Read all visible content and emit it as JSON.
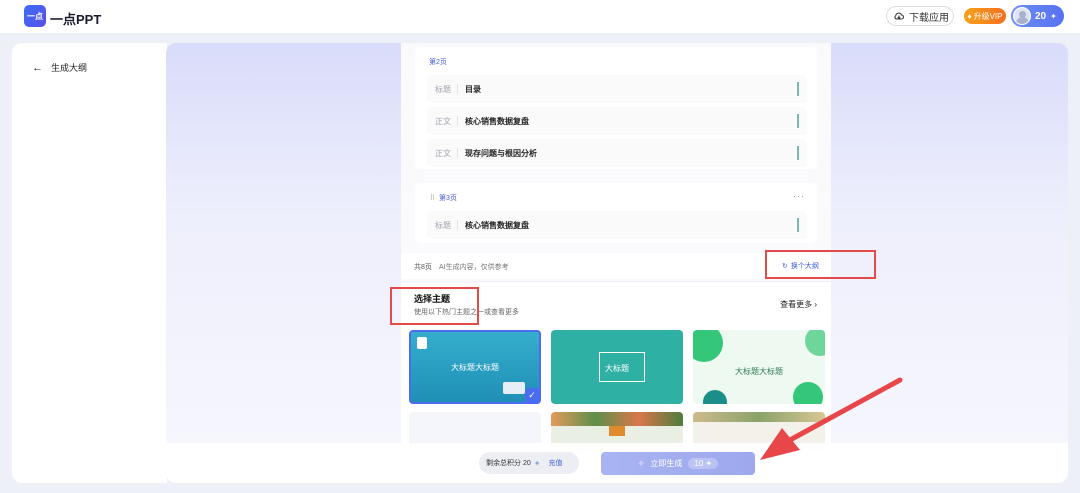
{
  "header": {
    "logo_text": "一点",
    "brand": "一点PPT",
    "download_label": "下载应用",
    "vip_label": "升级VIP",
    "points": "20"
  },
  "sidebar": {
    "back_label": "生成大纲"
  },
  "outline": {
    "pages": [
      {
        "label": "第2页",
        "rows": [
          {
            "type": "标题",
            "text": "目录"
          },
          {
            "type": "正文",
            "text": "核心销售数据复盘"
          },
          {
            "type": "正文",
            "text": "现存问题与根因分析"
          }
        ]
      },
      {
        "label": "第3页",
        "menu": "···",
        "rows": [
          {
            "type": "标题",
            "text": "核心销售数据复盘"
          }
        ]
      }
    ],
    "total": "共8页",
    "ai_note": "AI生成内容，仅供参考",
    "swap_label": "换个大纲"
  },
  "theme": {
    "title": "选择主题",
    "subtitle": "使用以下热门主题之一或查看更多",
    "see_more": "查看更多 ›",
    "cards": [
      {
        "text": "大标题大标题"
      },
      {
        "text": "大标题"
      },
      {
        "text": "大标题大标题"
      }
    ]
  },
  "bottom": {
    "credits_label": "剩余总积分 20",
    "recharge_label": "充值",
    "generate_label": "立即生成",
    "generate_cost": "10"
  },
  "colors": {
    "accent": "#4a6cf0",
    "annotation_red": "#e34a4a",
    "vip_orange": "#f7a21b"
  }
}
